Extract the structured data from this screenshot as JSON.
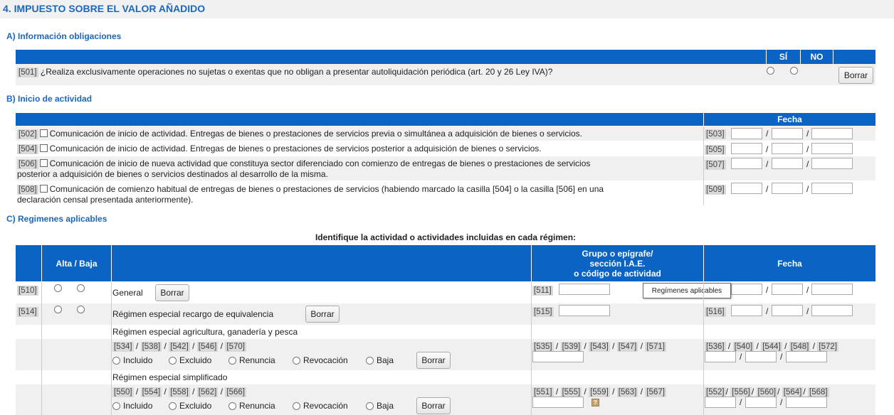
{
  "page": {
    "title": "4. IMPUESTO SOBRE EL VALOR AÑADIDO"
  },
  "sectionA": {
    "title": "A) Información obligaciones",
    "header": {
      "si": "SÍ",
      "no": "NO"
    },
    "row501": {
      "code": "[501]",
      "text": "¿Realiza exclusivamente operaciones no sujetas o exentas que no obligan a presentar autoliquidación periódica (art. 20 y 26 Ley IVA)?",
      "button": "Borrar"
    }
  },
  "sectionB": {
    "title": "B) Inicio de actividad",
    "header": {
      "fecha": "Fecha"
    },
    "rows": [
      {
        "code": "[502]",
        "line1": "Comunicación de inicio de actividad. Entregas de bienes o prestaciones de servicios previa o simultánea a adquisición de bienes o servicios.",
        "line2": "",
        "dateCode": "[503]"
      },
      {
        "code": "[504]",
        "line1": "Comunicación de inicio de actividad. Entregas de bienes o prestaciones de servicios posterior a adquisición de bienes o servicios.",
        "line2": "",
        "dateCode": "[505]"
      },
      {
        "code": "[506]",
        "line1": "Comunicación de inicio de nueva actividad que constituya sector diferenciado con comienzo de entregas de bienes o prestaciones de servicios",
        "line2": "posterior a adquisición de bienes o servicios destinados al desarrollo de la misma.",
        "dateCode": "[507]"
      },
      {
        "code": "[508]",
        "line1": "Comunicación de comienzo habitual de entregas de bienes o prestaciones de servicios (habiendo marcado la casilla [504] o la casilla [506] en una",
        "line2": "declaración censal presentada anteriormente).",
        "dateCode": "[509]"
      }
    ]
  },
  "sectionC": {
    "title": "C) Regimenes aplicables",
    "instruction": "Identifique la actividad o actividades incluidas en cada régimen:",
    "header": {
      "altaBaja": "Alta / Baja",
      "grupo1": "Grupo o epígrafe/",
      "grupo2": "sección I.A.E.",
      "grupo3": "o código de actividad",
      "fecha": "Fecha"
    },
    "general": {
      "code": "[510]",
      "label": "General",
      "button": "Borrar",
      "grupoCode": "[511]"
    },
    "recargo": {
      "code": "[514]",
      "label": "Régimen especial recargo de equivalencia",
      "button": "Borrar",
      "grupoCode": "[515]",
      "fechaCode": "[516]"
    },
    "agricultura": {
      "label": "Régimen especial agricultura, ganadería y pesca",
      "codes": [
        "[534]",
        "[538]",
        "[542]",
        "[546]",
        "[570]"
      ],
      "grupoCodes": [
        "[535]",
        "[539]",
        "[543]",
        "[547]",
        "[571]"
      ],
      "fechaCodes": [
        "[536]",
        "[540]",
        "[544]",
        "[548]",
        "[572]"
      ],
      "button": "Borrar"
    },
    "simplificado": {
      "label": "Régimen especial simplificado",
      "codes": [
        "[550]",
        "[554]",
        "[558]",
        "[562]",
        "[566]"
      ],
      "grupoCodes": [
        "[551]",
        "[555]",
        "[559]",
        "[563]",
        "[567]"
      ],
      "fechaCodes": [
        "[552]",
        "[556]",
        "[560]",
        "[564]",
        "[568]"
      ],
      "button": "Borrar"
    },
    "options": [
      "Incluido",
      "Excluido",
      "Renuncia",
      "Revocación",
      "Baja"
    ],
    "tooltip": "Regímenes aplicables",
    "help": "?"
  }
}
